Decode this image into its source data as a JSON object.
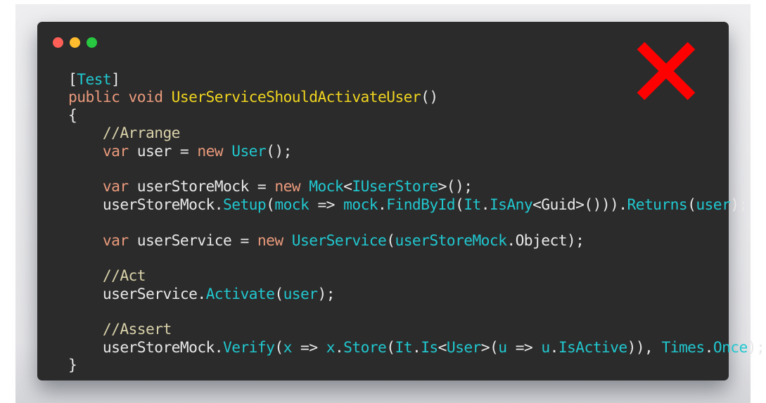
{
  "window_controls": {
    "close": "close",
    "minimize": "minimize",
    "maximize": "maximize"
  },
  "status_icon": "red-x-cross-icon",
  "colors": {
    "keyword": "#ea9a7c",
    "method_name": "#f0d51f",
    "type": "#21c7cf",
    "comment": "#d9d2aa",
    "plain": "#e8e8e8",
    "background": "#2b2b2b",
    "x_mark": "#ff0000"
  },
  "code_lines": [
    [
      [
        "[",
        "p"
      ],
      [
        "Test",
        "t"
      ],
      [
        "]",
        "p"
      ]
    ],
    [
      [
        "public void ",
        "k"
      ],
      [
        "UserServiceShouldActivateUser",
        "f"
      ],
      [
        "()",
        "p"
      ]
    ],
    [
      [
        "{",
        "p"
      ]
    ],
    [
      [
        "    ",
        "p"
      ],
      [
        "//Arrange",
        "c"
      ]
    ],
    [
      [
        "    ",
        "p"
      ],
      [
        "var",
        "k"
      ],
      [
        " user = ",
        "p"
      ],
      [
        "new ",
        "k"
      ],
      [
        "User",
        "t"
      ],
      [
        "();",
        "p"
      ]
    ],
    [],
    [
      [
        "    ",
        "p"
      ],
      [
        "var",
        "k"
      ],
      [
        " userStoreMock = ",
        "p"
      ],
      [
        "new ",
        "k"
      ],
      [
        "Mock",
        "t"
      ],
      [
        "<",
        "p"
      ],
      [
        "IUserStore",
        "t"
      ],
      [
        ">();",
        "p"
      ]
    ],
    [
      [
        "    userStoreMock.",
        "p"
      ],
      [
        "Setup",
        "t"
      ],
      [
        "(",
        "p"
      ],
      [
        "mock",
        "t"
      ],
      [
        " => ",
        "p"
      ],
      [
        "mock",
        "t"
      ],
      [
        ".",
        "p"
      ],
      [
        "FindById",
        "t"
      ],
      [
        "(",
        "p"
      ],
      [
        "It",
        "t"
      ],
      [
        ".",
        "p"
      ],
      [
        "IsAny",
        "t"
      ],
      [
        "<Guid>())).",
        "p"
      ],
      [
        "Returns",
        "t"
      ],
      [
        "(",
        "p"
      ],
      [
        "user",
        "t"
      ],
      [
        ");",
        "p"
      ]
    ],
    [],
    [
      [
        "    ",
        "p"
      ],
      [
        "var",
        "k"
      ],
      [
        " userService = ",
        "p"
      ],
      [
        "new ",
        "k"
      ],
      [
        "UserService",
        "t"
      ],
      [
        "(",
        "p"
      ],
      [
        "userStoreMock",
        "t"
      ],
      [
        ".Object);",
        "p"
      ]
    ],
    [],
    [
      [
        "    ",
        "p"
      ],
      [
        "//Act",
        "c"
      ]
    ],
    [
      [
        "    userService.",
        "p"
      ],
      [
        "Activate",
        "t"
      ],
      [
        "(",
        "p"
      ],
      [
        "user",
        "t"
      ],
      [
        ");",
        "p"
      ]
    ],
    [],
    [
      [
        "    ",
        "p"
      ],
      [
        "//Assert",
        "c"
      ]
    ],
    [
      [
        "    userStoreMock.",
        "p"
      ],
      [
        "Verify",
        "t"
      ],
      [
        "(",
        "p"
      ],
      [
        "x",
        "t"
      ],
      [
        " => ",
        "p"
      ],
      [
        "x",
        "t"
      ],
      [
        ".",
        "p"
      ],
      [
        "Store",
        "t"
      ],
      [
        "(",
        "p"
      ],
      [
        "It",
        "t"
      ],
      [
        ".",
        "p"
      ],
      [
        "Is",
        "t"
      ],
      [
        "<",
        "p"
      ],
      [
        "User",
        "t"
      ],
      [
        ">(",
        "p"
      ],
      [
        "u",
        "t"
      ],
      [
        " => ",
        "p"
      ],
      [
        "u",
        "t"
      ],
      [
        ".",
        "p"
      ],
      [
        "IsActive",
        "t"
      ],
      [
        ")), ",
        "p"
      ],
      [
        "Times",
        "t"
      ],
      [
        ".",
        "p"
      ],
      [
        "Once",
        "t"
      ],
      [
        ");",
        "p"
      ]
    ],
    [
      [
        "}",
        "p"
      ]
    ]
  ]
}
